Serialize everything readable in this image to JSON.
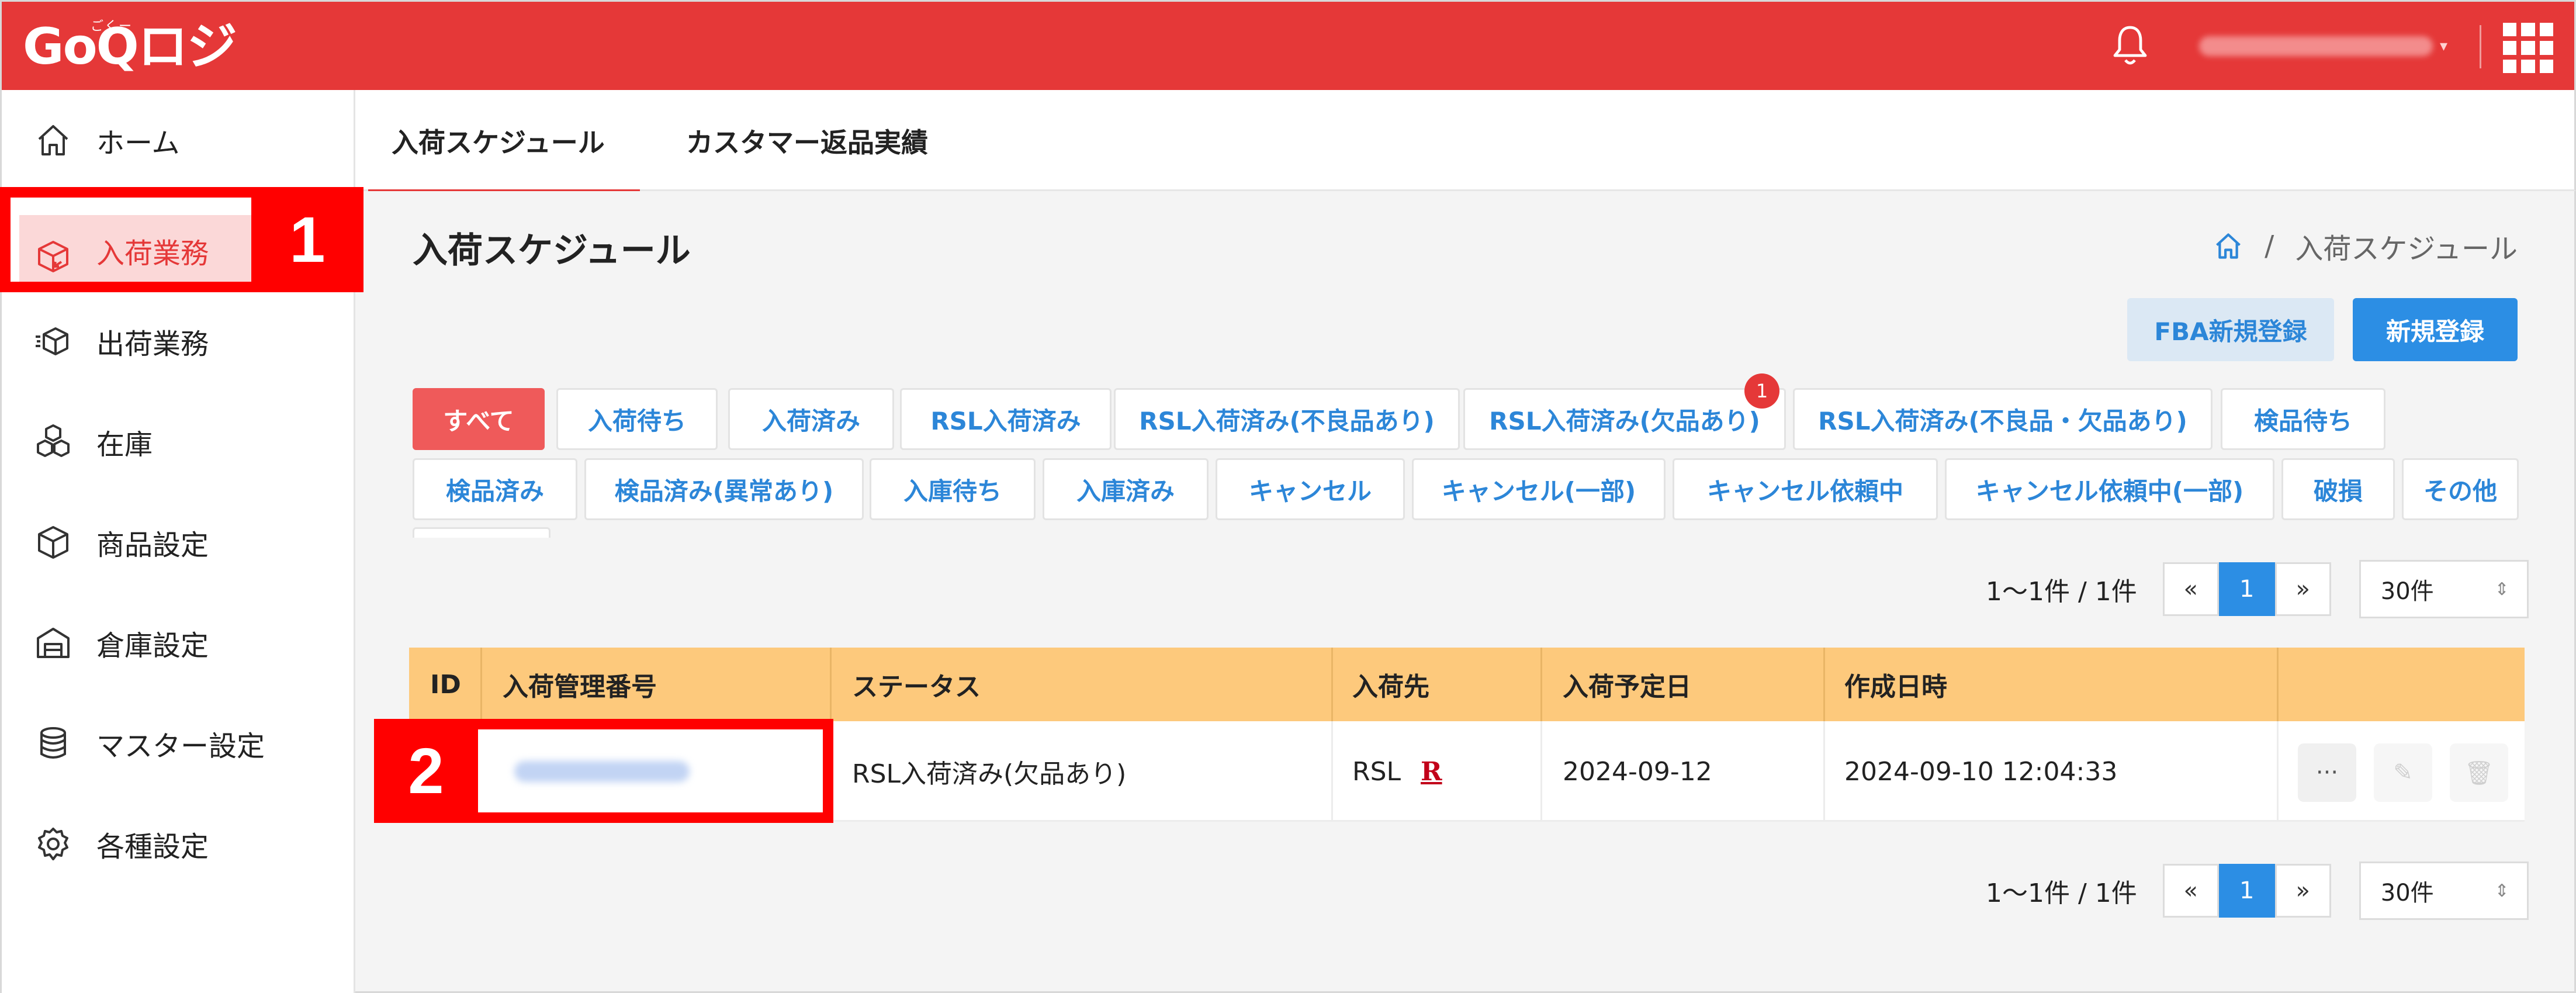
{
  "header": {
    "logo_text": "GoQロジ",
    "logo_ruby": "ごくー",
    "bell_icon": "bell-icon",
    "apps_icon": "grid-apps-icon"
  },
  "sidebar": {
    "items": [
      {
        "label": "ホーム",
        "icon": "home-icon"
      },
      {
        "label": "入荷業務",
        "icon": "inbound-box-icon",
        "active": true
      },
      {
        "label": "出荷業務",
        "icon": "outbound-box-icon"
      },
      {
        "label": "在庫",
        "icon": "stock-cubes-icon"
      },
      {
        "label": "商品設定",
        "icon": "cube-icon"
      },
      {
        "label": "倉庫設定",
        "icon": "warehouse-icon"
      },
      {
        "label": "マスター設定",
        "icon": "database-icon"
      },
      {
        "label": "各種設定",
        "icon": "gear-icon"
      }
    ]
  },
  "tabs": [
    {
      "label": "入荷スケジュール",
      "active": true
    },
    {
      "label": "カスタマー返品実績"
    }
  ],
  "page": {
    "title": "入荷スケジュール",
    "breadcrumb": {
      "current": "入荷スケジュール",
      "separator": "/"
    },
    "buttons": {
      "fba_new": "FBA新規登録",
      "new": "新規登録"
    }
  },
  "filters": [
    "すべて",
    "入荷待ち",
    "入荷済み",
    "RSL入荷済み",
    "RSL入荷済み(不良品あり)",
    "RSL入荷済み(欠品あり)",
    "RSL入荷済み(不良品・欠品あり)",
    "検品待ち",
    "検品済み",
    "検品済み(異常あり)",
    "入庫待ち",
    "入庫済み",
    "キャンセル",
    "キャンセル(一部)",
    "キャンセル依頼中",
    "キャンセル依頼中(一部)",
    "破損",
    "その他"
  ],
  "filter_badge": "1",
  "pagination": {
    "count_text": "1〜1件 / 1件",
    "prev": "«",
    "current": "1",
    "next": "»",
    "per_page": "30件"
  },
  "table": {
    "columns": [
      "ID",
      "入荷管理番号",
      "ステータス",
      "入荷先",
      "入荷予定日",
      "作成日時"
    ],
    "rows": [
      {
        "status": "RSL入荷済み(欠品あり)",
        "destination": "RSL",
        "destination_badge": "R",
        "scheduled_date": "2024-09-12",
        "created_at": "2024-09-10 12:04:33"
      }
    ],
    "actions": {
      "more": "···",
      "edit_icon": "pencil-icon",
      "delete_icon": "trash-icon"
    }
  },
  "callouts": [
    "1",
    "2"
  ],
  "colors": {
    "brand_red": "#e53838",
    "accent_blue": "#2c8ee4",
    "table_header": "#fdc97c",
    "callout_red": "#ff0000"
  }
}
